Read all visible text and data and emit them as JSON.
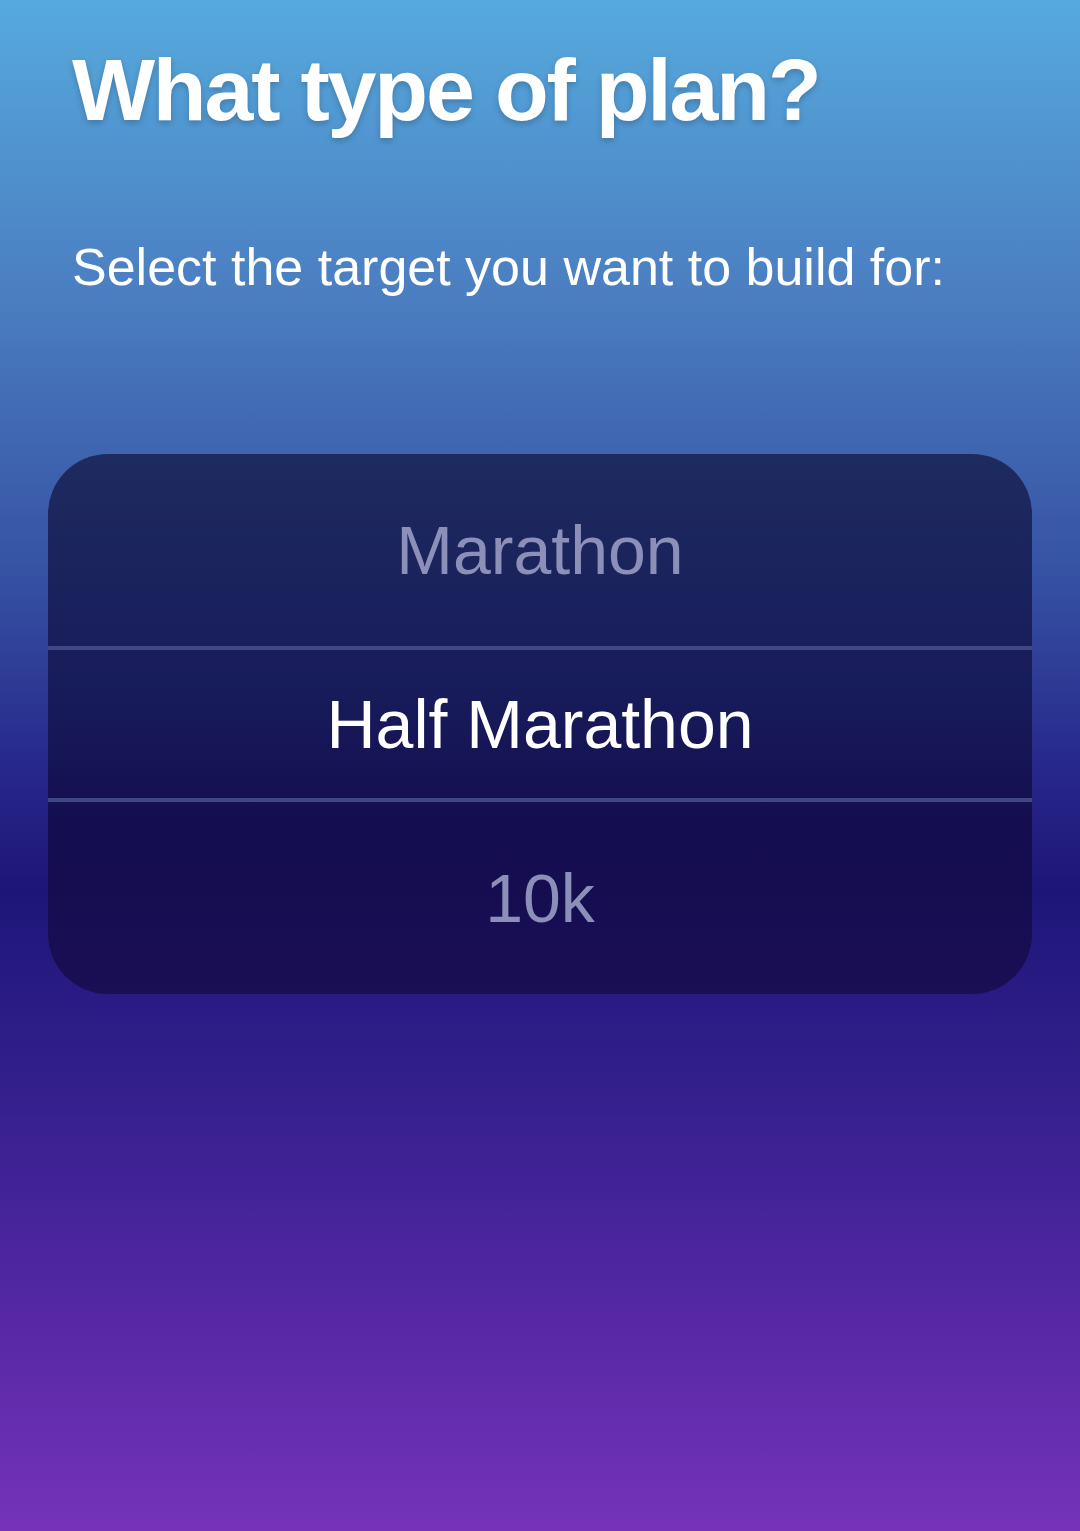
{
  "title": "What type of plan?",
  "subtitle": "Select the target you want to build for:",
  "picker": {
    "options": [
      {
        "label": "Marathon",
        "selected": false
      },
      {
        "label": "Half Marathon",
        "selected": true
      },
      {
        "label": "10k",
        "selected": false
      }
    ]
  }
}
